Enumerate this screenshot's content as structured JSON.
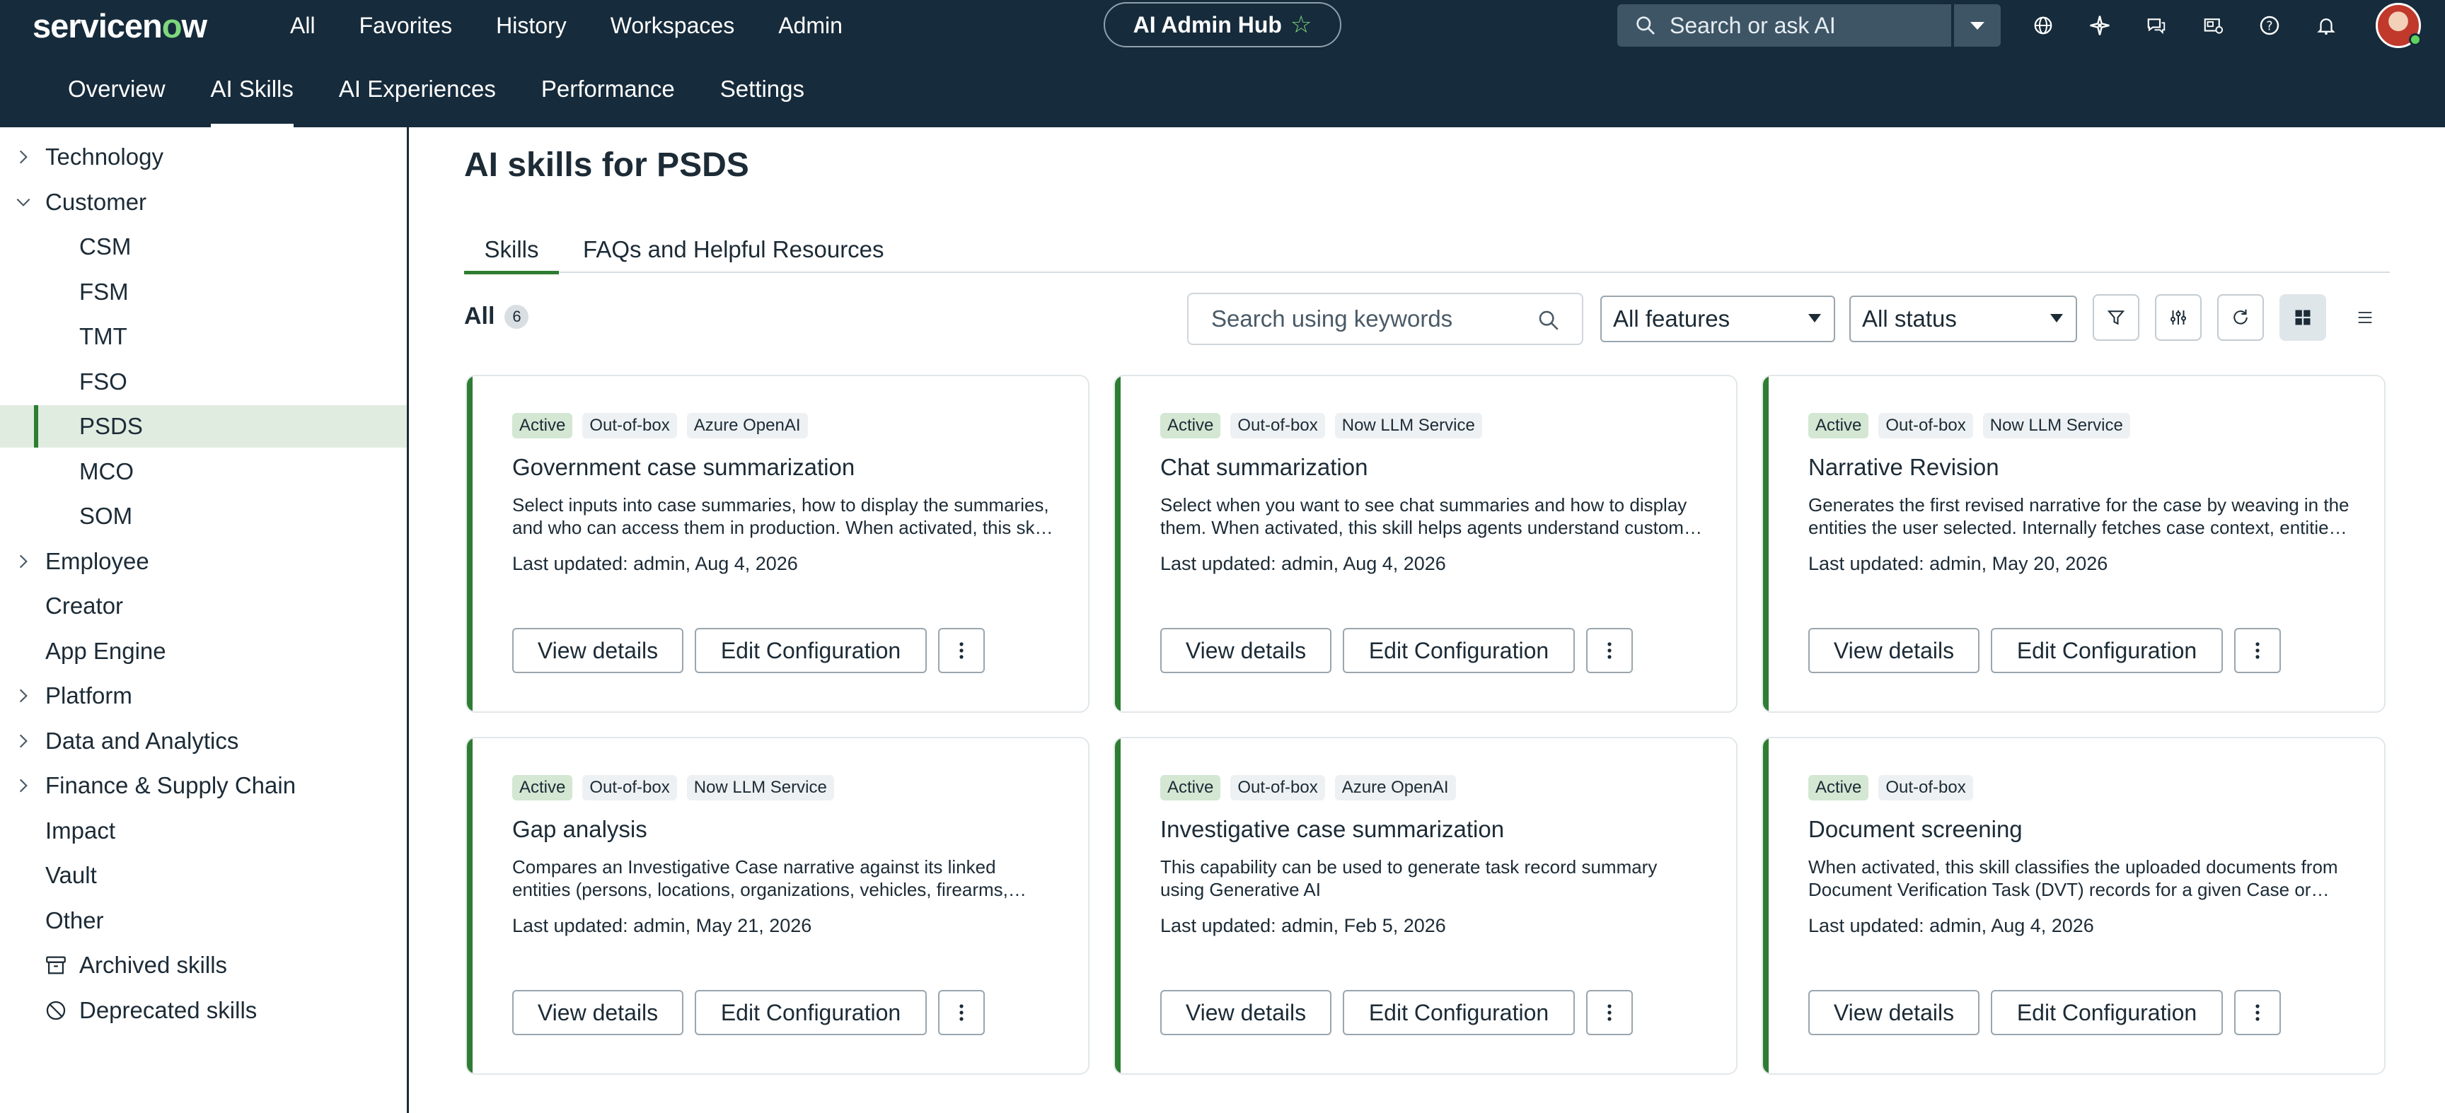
{
  "app": {
    "logo": "servicenow",
    "nav": [
      "All",
      "Favorites",
      "History",
      "Workspaces",
      "Admin"
    ],
    "hub_title": "AI Admin Hub",
    "search_placeholder": "Search or ask AI",
    "top_icons": [
      "globe-icon",
      "sparkle-icon",
      "chat-icon",
      "inbox-icon",
      "help-icon",
      "bell-icon"
    ]
  },
  "subnav": {
    "tabs": [
      "Overview",
      "AI Skills",
      "AI Experiences",
      "Performance",
      "Settings"
    ],
    "active": "AI Skills"
  },
  "sidebar": {
    "items": [
      {
        "label": "Technology",
        "expandable": true,
        "expanded": false
      },
      {
        "label": "Customer",
        "expandable": true,
        "expanded": true
      },
      {
        "label": "CSM",
        "child": true
      },
      {
        "label": "FSM",
        "child": true
      },
      {
        "label": "TMT",
        "child": true
      },
      {
        "label": "FSO",
        "child": true
      },
      {
        "label": "PSDS",
        "child": true,
        "selected": true
      },
      {
        "label": "MCO",
        "child": true
      },
      {
        "label": "SOM",
        "child": true
      },
      {
        "label": "Employee",
        "expandable": true,
        "expanded": false
      },
      {
        "label": "Creator"
      },
      {
        "label": "App Engine"
      },
      {
        "label": "Platform",
        "expandable": true,
        "expanded": false
      },
      {
        "label": "Data and Analytics",
        "expandable": true,
        "expanded": false
      },
      {
        "label": "Finance & Supply Chain",
        "expandable": true,
        "expanded": false
      },
      {
        "label": "Impact"
      },
      {
        "label": "Vault"
      },
      {
        "label": "Other"
      },
      {
        "label": "Archived skills",
        "icon": "archive-icon"
      },
      {
        "label": "Deprecated skills",
        "icon": "deprecated-icon"
      }
    ]
  },
  "main": {
    "title": "AI skills for PSDS",
    "tabs": [
      "Skills",
      "FAQs and Helpful Resources"
    ],
    "all_label": "All",
    "all_count": "6",
    "search_placeholder": "Search using keywords",
    "feature_filter": "All features",
    "status_filter": "All status",
    "view_details_label": "View details",
    "edit_config_label": "Edit Configuration"
  },
  "cards": [
    {
      "badges": [
        "Active",
        "Out-of-box",
        "Azure OpenAI"
      ],
      "title": "Government case summarization",
      "description": "Select inputs into case summaries, how to display the summaries, and who can access them in production. When activated, this skill helps agents understand case details quickly.",
      "updated": "Last updated: admin, Aug 4, 2026"
    },
    {
      "badges": [
        "Active",
        "Out-of-box",
        "Now LLM Service"
      ],
      "title": "Chat summarization",
      "description": "Select when you want to see chat summaries and how to display them. When activated, this skill helps agents understand customer conversations quickly.",
      "updated": "Last updated: admin, Aug 4, 2026"
    },
    {
      "badges": [
        "Active",
        "Out-of-box",
        "Now LLM Service"
      ],
      "title": "Narrative Revision",
      "description": "Generates the first revised narrative for the case by weaving in the entities the user selected. Internally fetches case context, entities and related records.",
      "updated": "Last updated: admin, May 20, 2026"
    },
    {
      "badges": [
        "Active",
        "Out-of-box",
        "Now LLM Service"
      ],
      "title": "Gap analysis",
      "description": "Compares an Investigative Case narrative against its linked entities (persons, locations, organizations, vehicles, firearms, properties, and more).",
      "updated": "Last updated: admin, May 21, 2026"
    },
    {
      "badges": [
        "Active",
        "Out-of-box",
        "Azure OpenAI"
      ],
      "title": "Investigative case summarization",
      "description": "This capability can be used to generate task record summary using Generative AI",
      "updated": "Last updated: admin, Feb 5, 2026"
    },
    {
      "badges": [
        "Active",
        "Out-of-box"
      ],
      "title": "Document screening",
      "description": "When activated, this skill classifies the uploaded documents from Document Verification Task (DVT) records for a given Case or Task.",
      "updated": "Last updated: admin, Aug 4, 2026"
    }
  ],
  "colors": {
    "header_bg": "#162b3b",
    "accent_green": "#2e7d32",
    "active_badge": "#d3e7d3",
    "selected_row": "#e1ece1"
  }
}
